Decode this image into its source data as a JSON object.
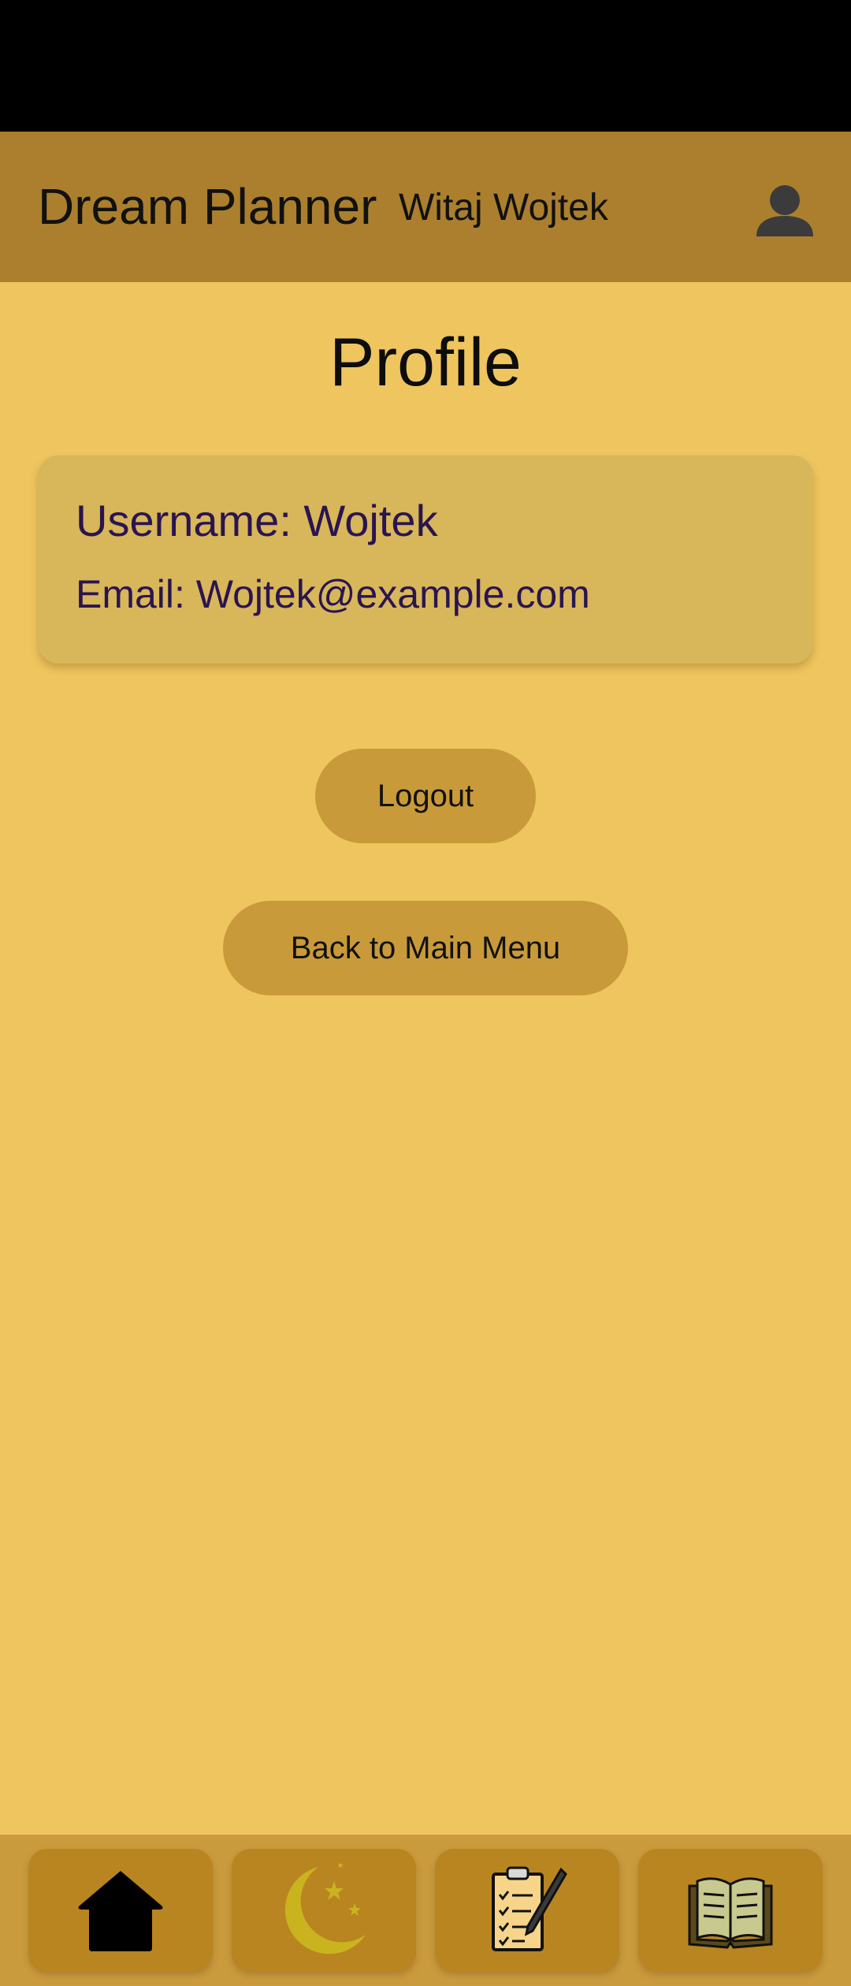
{
  "app_bar": {
    "title": "Dream Planner",
    "greeting": "Witaj Wojtek",
    "profile_icon": "person-icon"
  },
  "page": {
    "title": "Profile"
  },
  "profile_card": {
    "username": "Username: Wojtek",
    "email": "Email: Wojtek@example.com"
  },
  "actions": {
    "logout_label": "Logout",
    "back_label": "Back to Main Menu"
  },
  "bottom_nav": {
    "items": [
      {
        "icon": "home-icon"
      },
      {
        "icon": "moon-stars-icon"
      },
      {
        "icon": "clipboard-checklist-icon"
      },
      {
        "icon": "open-book-icon"
      }
    ]
  },
  "colors": {
    "background": "#EFC55F",
    "app_bar": "#AB7F2D",
    "card": "#D8B65A",
    "button": "#C99A39",
    "nav_bar": "#C99B3D",
    "nav_item": "#B98521",
    "card_text": "#2a1550"
  }
}
